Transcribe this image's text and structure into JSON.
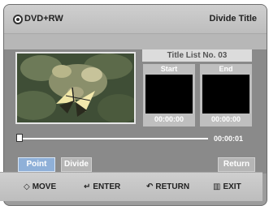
{
  "header": {
    "disc_label": "DVD+RW",
    "title": "Divide Title"
  },
  "panel": {
    "title_list": "Title List No. 03",
    "start": {
      "label": "Start",
      "time": "00:00:00"
    },
    "end": {
      "label": "End",
      "time": "00:00:00"
    }
  },
  "timeline": {
    "time": "00:00:01"
  },
  "buttons": {
    "point": "Point",
    "divide": "Divide",
    "return": "Return"
  },
  "footer": {
    "move": "MOVE",
    "enter": "ENTER",
    "return": "RETURN",
    "exit": "EXIT"
  },
  "icons": {
    "disc": "disc-icon",
    "move": "four-way-arrow-icon",
    "enter": "enter-icon",
    "return": "return-icon",
    "exit": "exit-icon"
  }
}
